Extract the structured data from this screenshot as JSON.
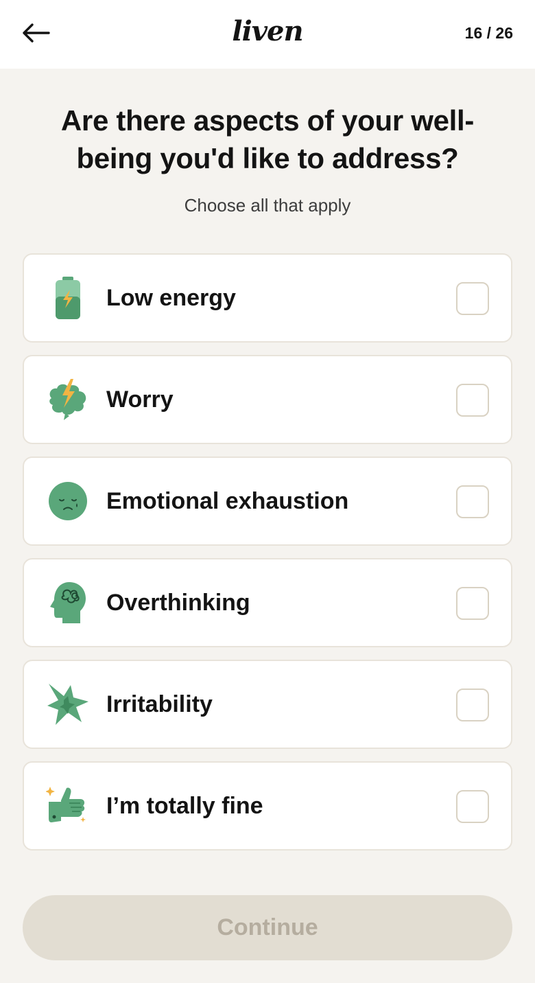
{
  "header": {
    "logo": "liven",
    "progress": "16 / 26"
  },
  "question": {
    "title": "Are there aspects of your well-being you'd like to address?",
    "subtitle": "Choose all that apply"
  },
  "options": [
    {
      "label": "Low energy",
      "icon": "battery-icon",
      "checked": false
    },
    {
      "label": "Worry",
      "icon": "brain-lightning-icon",
      "checked": false
    },
    {
      "label": "Emotional exhaustion",
      "icon": "sad-face-icon",
      "checked": false
    },
    {
      "label": "Overthinking",
      "icon": "head-tangle-icon",
      "checked": false
    },
    {
      "label": "Irritability",
      "icon": "burst-icon",
      "checked": false
    },
    {
      "label": "I’m totally fine",
      "icon": "thumbs-up-icon",
      "checked": false
    }
  ],
  "continue_label": "Continue",
  "colors": {
    "background": "#f5f3ef",
    "accent_green": "#5aa77a",
    "accent_yellow": "#f2b443",
    "button_disabled": "#e2ddd2"
  }
}
